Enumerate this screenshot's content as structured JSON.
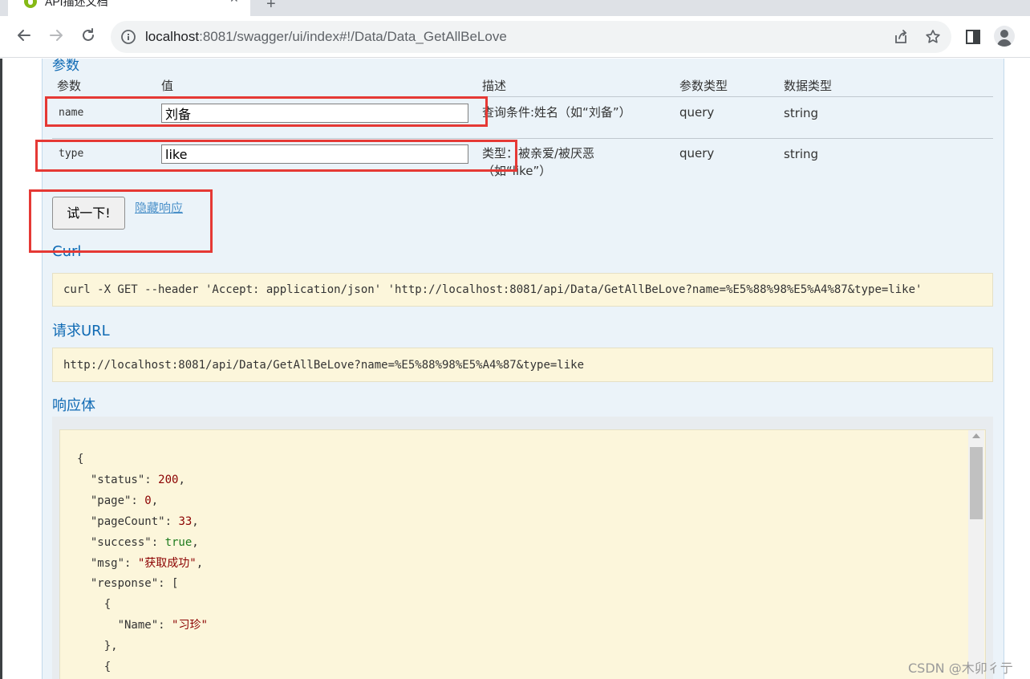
{
  "browser": {
    "tab_title": "API描述文档",
    "url_host": "localhost",
    "url_rest": ":8081/swagger/ui/index#!/Data/Data_GetAllBeLove"
  },
  "params": {
    "section_title": "参数",
    "headers": {
      "param": "参数",
      "value": "值",
      "description": "描述",
      "param_type": "参数类型",
      "data_type": "数据类型"
    },
    "rows": [
      {
        "name": "name",
        "value": "刘备",
        "description": "查询条件:姓名（如“刘备”）",
        "param_type": "query",
        "data_type": "string"
      },
      {
        "name": "type",
        "value": "like",
        "description": "类型：被亲爱/被厌恶（如“like”）",
        "param_type": "query",
        "data_type": "string"
      }
    ]
  },
  "actions": {
    "try_button": "试一下!",
    "hide_link": "隐藏响应"
  },
  "curl": {
    "title": "Curl",
    "command": "curl -X GET --header 'Accept: application/json' 'http://localhost:8081/api/Data/GetAllBeLove?name=%E5%88%98%E5%A4%87&type=like'"
  },
  "request_url": {
    "title": "请求URL",
    "value": "http://localhost:8081/api/Data/GetAllBeLove?name=%E5%88%98%E5%A4%87&type=like"
  },
  "response_body": {
    "title": "响应体",
    "status": "200",
    "page": "0",
    "pageCount": "33",
    "success": "true",
    "msg": "\"获取成功\"",
    "first_name": "\"习珍\""
  },
  "watermark": "CSDN @木卯彳亍",
  "colors": {
    "link_blue": "#0f6ab4",
    "panel_bg": "#ebf3f9",
    "code_bg": "#fcf6db",
    "annotation_red": "#e53935"
  }
}
